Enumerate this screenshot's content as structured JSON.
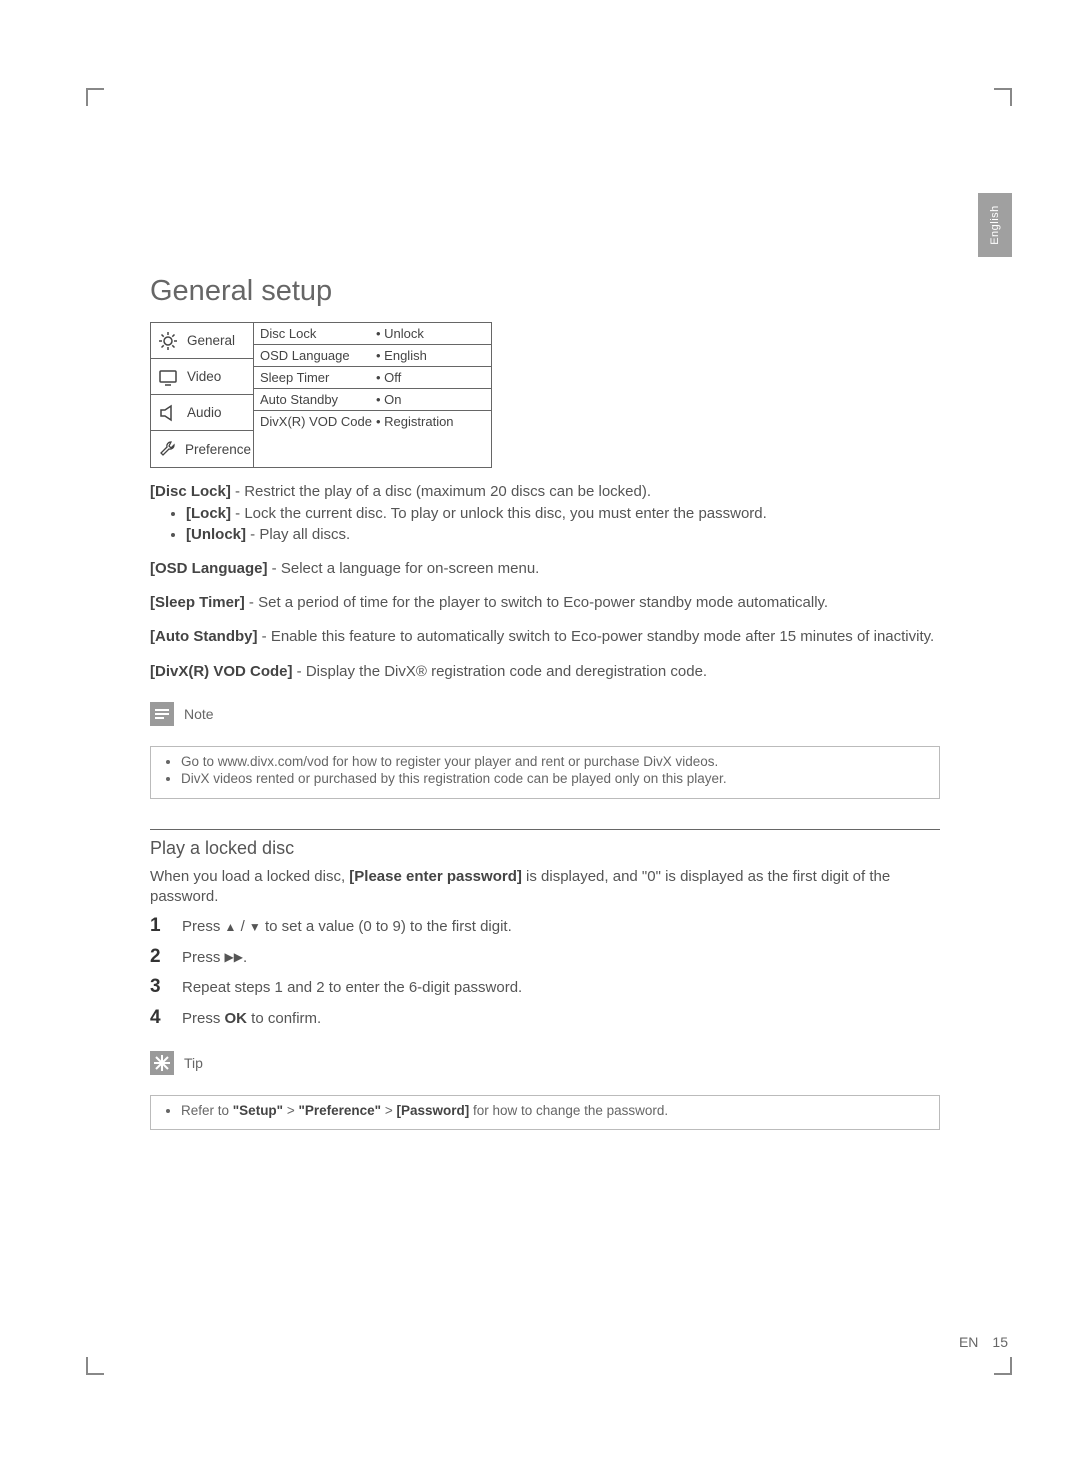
{
  "side_tab": "English",
  "heading": "General setup",
  "menu": {
    "items": [
      {
        "label": "General"
      },
      {
        "label": "Video"
      },
      {
        "label": "Audio"
      },
      {
        "label": "Preference"
      }
    ],
    "rows": [
      {
        "key": "Disc Lock",
        "value": "Unlock"
      },
      {
        "key": "OSD Language",
        "value": "English"
      },
      {
        "key": "Sleep Timer",
        "value": "Off"
      },
      {
        "key": "Auto Standby",
        "value": "On"
      },
      {
        "key": "DivX(R) VOD Code",
        "value": "Registration"
      }
    ]
  },
  "desc": {
    "disc_lock_label": "[Disc Lock]",
    "disc_lock_text": " - Restrict the play of a disc (maximum 20 discs can be locked).",
    "lock_label": "[Lock]",
    "lock_text": " - Lock the current disc. To play or unlock this disc, you must enter the password.",
    "unlock_label": "[Unlock]",
    "unlock_text": " - Play all discs.",
    "osd_label": "[OSD Language]",
    "osd_text": " - Select a language for on-screen menu.",
    "sleep_label": "[Sleep Timer]",
    "sleep_text": " - Set a period of time for the player to switch to Eco-power standby mode automatically.",
    "auto_label": "[Auto Standby]",
    "auto_text": " - Enable this feature to automatically switch to Eco-power standby mode after 15 minutes of inactivity.",
    "divx_label": "[DivX(R) VOD Code]",
    "divx_text": " - Display the DivX® registration code and deregistration code."
  },
  "note": {
    "title": "Note",
    "items": [
      "Go to www.divx.com/vod for how to register your player and rent or purchase DivX videos.",
      "DivX videos rented or purchased by this registration code can be played only on this player."
    ]
  },
  "play_locked": {
    "title": "Play a locked disc",
    "intro_a": "When you load a locked disc, ",
    "intro_bold": "[Please enter password]",
    "intro_b": " is displayed, and \"0\" is displayed as the first digit of the password.",
    "steps": {
      "s1a": "Press ",
      "s1b": " to set a value (0 to 9) to the first digit.",
      "s2a": "Press ",
      "s2b": ".",
      "s3": "Repeat steps 1 and 2 to enter the 6-digit password.",
      "s4a": "Press ",
      "s4ok": "OK",
      "s4b": " to confirm."
    }
  },
  "tip": {
    "title": "Tip",
    "text_a": "Refer to ",
    "q1": "\"Setup\"",
    "gt1": " > ",
    "q2": "\"Preference\"",
    "gt2": " > ",
    "b3": "[Password]",
    "text_b": " for how to change the password."
  },
  "footer": {
    "lang": "EN",
    "page": "15"
  }
}
